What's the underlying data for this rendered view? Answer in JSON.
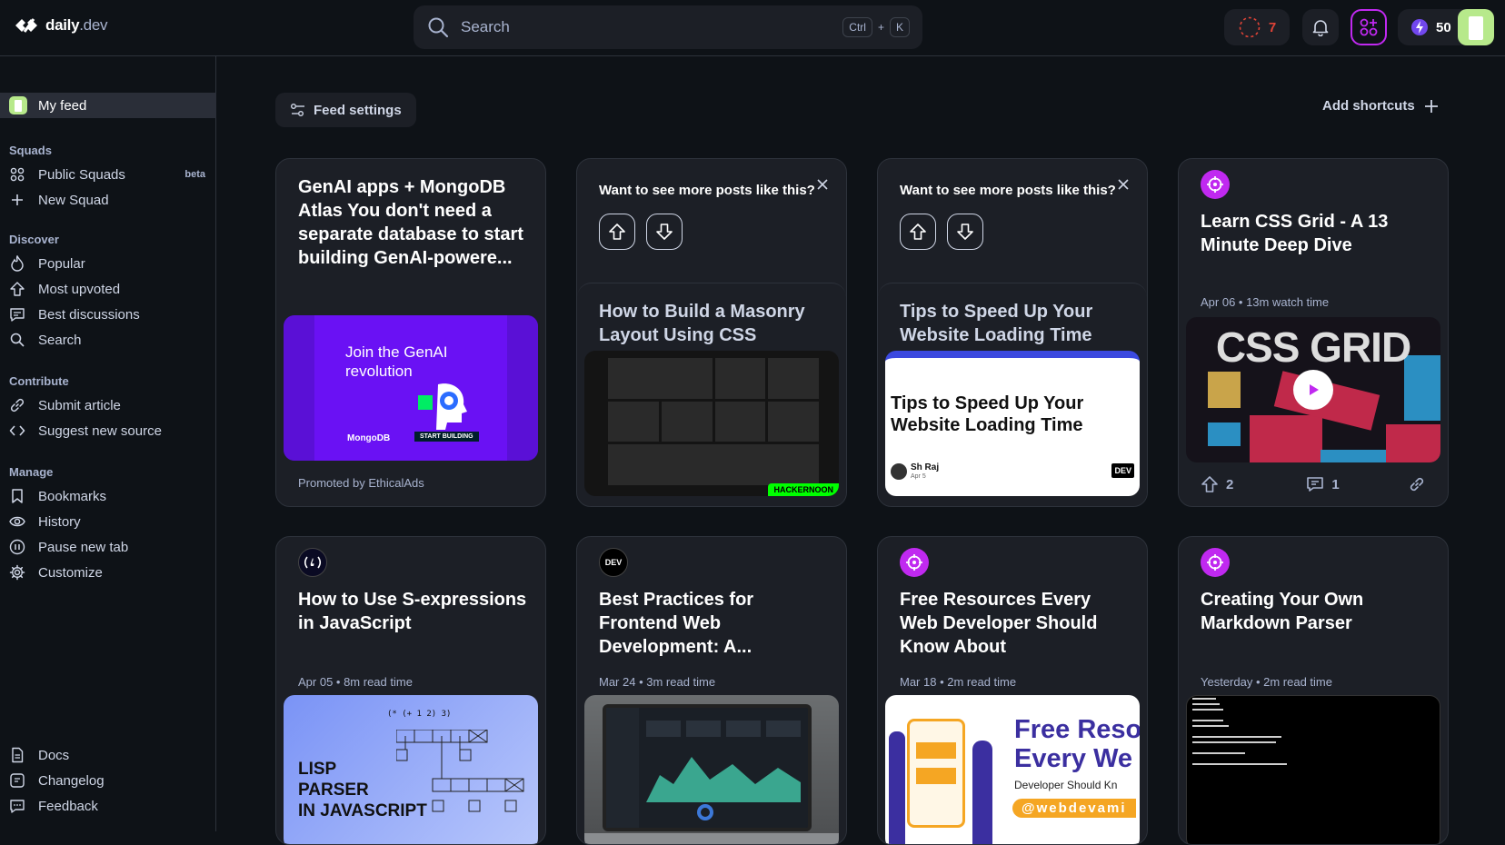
{
  "topbar": {
    "logo_name": "daily",
    "logo_suffix": ".dev",
    "search_placeholder": "Search",
    "shortcut_key1": "Ctrl",
    "shortcut_plus": "+",
    "shortcut_key2": "K",
    "streak_count": "7",
    "reputation": "50"
  },
  "sidebar": {
    "my_feed": "My feed",
    "squads_title": "Squads",
    "public_squads": "Public Squads",
    "beta_badge": "beta",
    "new_squad": "New Squad",
    "discover_title": "Discover",
    "popular": "Popular",
    "most_upvoted": "Most upvoted",
    "best_discussions": "Best discussions",
    "search": "Search",
    "contribute_title": "Contribute",
    "submit_article": "Submit article",
    "suggest_source": "Suggest new source",
    "manage_title": "Manage",
    "bookmarks": "Bookmarks",
    "history": "History",
    "pause_tab": "Pause new tab",
    "customize": "Customize",
    "docs": "Docs",
    "changelog": "Changelog",
    "feedback": "Feedback"
  },
  "toolbar": {
    "feed_settings": "Feed settings",
    "add_shortcuts": "Add shortcuts"
  },
  "cards": {
    "promo": {
      "title": "GenAI apps + MongoDB Atlas You don't need a separate database to start building GenAI-powere...",
      "ad_headline": "Join the GenAI revolution",
      "ad_brand": "MongoDB",
      "ad_cta": "START BUILDING",
      "label": "Promoted by EthicalAds"
    },
    "ask1": {
      "question": "Want to see more posts like this?",
      "title": "How to Build a Masonry Layout Using CSS",
      "thumb_badge": "HACKERNOON"
    },
    "ask2": {
      "question": "Want to see more posts like this?",
      "title": "Tips to Speed Up Your Website Loading Time",
      "thumb_title": "Tips to Speed Up Your Website Loading Time",
      "thumb_author": "Sh Raj",
      "thumb_date": "Apr 5",
      "thumb_badge": "DEV"
    },
    "css_grid": {
      "title": "Learn CSS Grid - A 13 Minute Deep Dive",
      "meta": "Apr 06 • 13m watch time",
      "thumb_text": "CSS GRID",
      "upvotes": "2",
      "comments": "1"
    },
    "sexpr": {
      "title": "How to Use S-expressions in JavaScript",
      "meta": "Apr 05 • 8m read time",
      "thumb_code": "(* (+ 1 2) 3)",
      "thumb_text": "LISP\nPARSER\nIN JAVASCRIPT"
    },
    "best_practices": {
      "title": "Best Practices for Frontend Web Development: A...",
      "meta": "Mar 24 • 3m read time",
      "src": "DEV"
    },
    "free_resources": {
      "title": "Free Resources Every Web Developer Should Know About",
      "meta": "Mar 18 • 2m read time",
      "thumb_line1": "Free Reso",
      "thumb_line2": "Every We",
      "thumb_sub": "Developer Should Kn",
      "thumb_handle": "@webdevami"
    },
    "markdown": {
      "title": "Creating Your Own Markdown Parser",
      "meta": "Yesterday • 2m read time"
    }
  },
  "colors": {
    "background": "#0e1217",
    "card": "#1c1f26",
    "accent_purple": "#c029f0",
    "streak_red": "#e04337"
  }
}
